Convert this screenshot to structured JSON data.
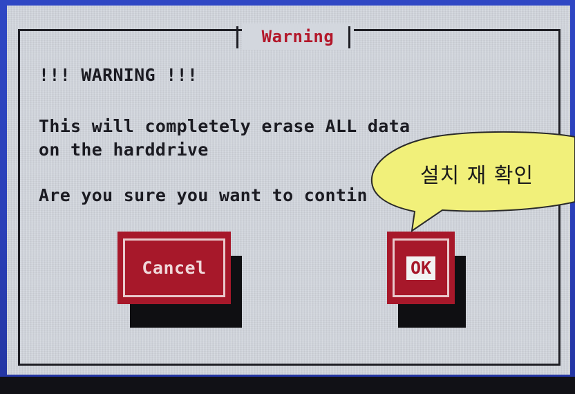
{
  "dialog": {
    "title": "Warning",
    "heading": "!!! WARNING !!!",
    "message_line1": "This will completely erase ALL data",
    "message_line2": "on the harddrive",
    "question": "Are you sure you want to contin",
    "cancel_label": "Cancel",
    "ok_label": "OK"
  },
  "callout": {
    "text": "설치 재 확인"
  },
  "colors": {
    "screen_blue": "#2f47c4",
    "dialog_gray": "#d3d7de",
    "button_red": "#a7182a",
    "title_red": "#b3172a",
    "callout_yellow": "#f1f07a"
  }
}
